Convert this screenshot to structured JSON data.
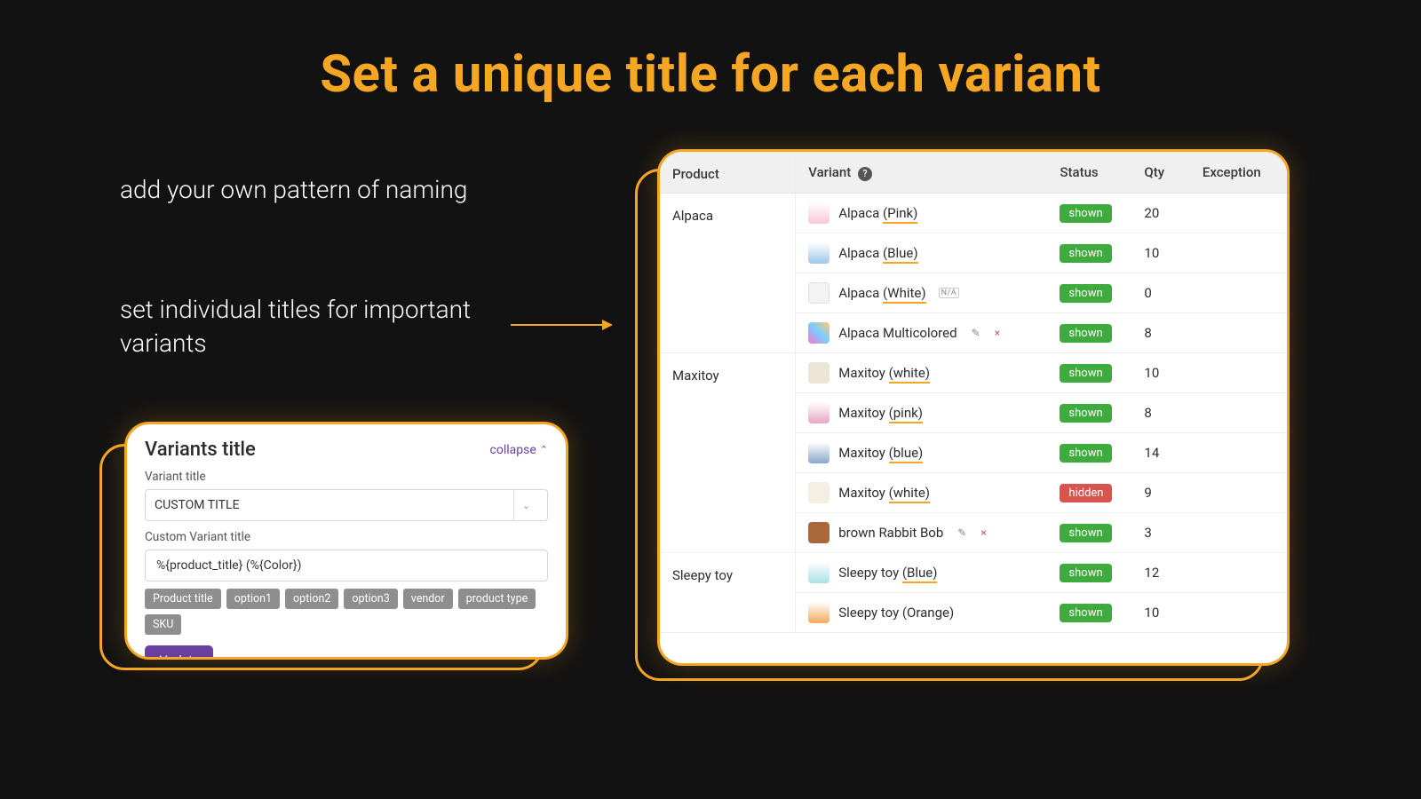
{
  "headline": "Set a unique title for each variant",
  "text1": "add your own pattern of naming",
  "text2": "set individual titles for important variants",
  "left": {
    "card_title": "Variants title",
    "collapse": "collapse",
    "label_variant_title": "Variant title",
    "select_value": "CUSTOM TITLE",
    "label_custom": "Custom Variant title",
    "input_value": "%{product_title} (%{Color})",
    "chips": [
      "Product title",
      "option1",
      "option2",
      "option3",
      "vendor",
      "product type",
      "SKU"
    ],
    "update": "Update"
  },
  "table": {
    "headers": {
      "product": "Product",
      "variant": "Variant",
      "status": "Status",
      "qty": "Qty",
      "exception": "Exception"
    },
    "groups": [
      {
        "product": "Alpaca",
        "rows": [
          {
            "pre": "Alpaca ",
            "ul": "(Pink)",
            "thumb": "th-pink",
            "status": "shown",
            "qty": "20",
            "na": false,
            "edit": false
          },
          {
            "pre": "Alpaca ",
            "ul": "(Blue)",
            "thumb": "th-blue",
            "status": "shown",
            "qty": "10",
            "na": false,
            "edit": false
          },
          {
            "pre": "Alpaca ",
            "ul": "(White)",
            "thumb": "th-white",
            "status": "shown",
            "qty": "0",
            "na": true,
            "edit": false
          },
          {
            "pre": "Alpaca Multicolored",
            "ul": "",
            "thumb": "th-multi",
            "status": "shown",
            "qty": "8",
            "na": false,
            "edit": true
          }
        ]
      },
      {
        "product": "Maxitoy",
        "rows": [
          {
            "pre": "Maxitoy ",
            "ul": "(white)",
            "thumb": "th-mwhite",
            "status": "shown",
            "qty": "10",
            "na": false,
            "edit": false
          },
          {
            "pre": "Maxitoy ",
            "ul": "(pink)",
            "thumb": "th-mpink",
            "status": "shown",
            "qty": "8",
            "na": false,
            "edit": false
          },
          {
            "pre": "Maxitoy ",
            "ul": "(blue)",
            "thumb": "th-mblue",
            "status": "shown",
            "qty": "14",
            "na": false,
            "edit": false
          },
          {
            "pre": "Maxitoy ",
            "ul": "(white)",
            "thumb": "th-mwhite2",
            "status": "hidden",
            "qty": "9",
            "na": false,
            "edit": false
          },
          {
            "pre": "brown Rabbit Bob",
            "ul": "",
            "thumb": "th-brown",
            "status": "shown",
            "qty": "3",
            "na": false,
            "edit": true
          }
        ]
      },
      {
        "product": "Sleepy toy",
        "rows": [
          {
            "pre": "Sleepy toy ",
            "ul": "(Blue)",
            "thumb": "th-sblue",
            "status": "shown",
            "qty": "12",
            "na": false,
            "edit": false
          },
          {
            "pre": "Sleepy toy (Orange)",
            "ul": "",
            "thumb": "th-sorange",
            "status": "shown",
            "qty": "10",
            "na": false,
            "edit": false
          }
        ]
      }
    ]
  }
}
